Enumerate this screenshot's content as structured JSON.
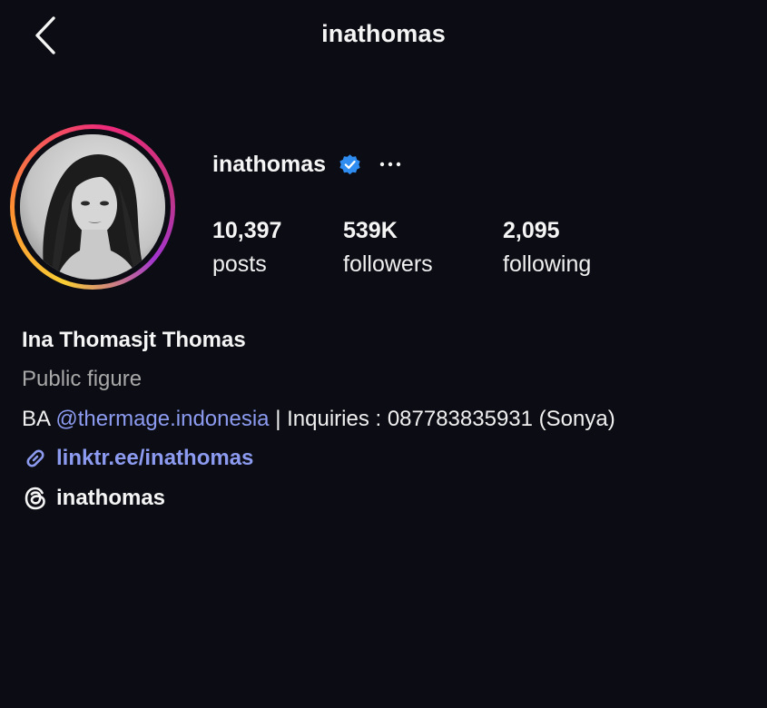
{
  "header": {
    "title": "inathomas",
    "back_icon": "chevron-left-icon"
  },
  "profile": {
    "username": "inathomas",
    "verified_icon": "verified-badge-icon",
    "more_icon": "ellipsis-icon",
    "stats": [
      {
        "value": "10,397",
        "label": "posts"
      },
      {
        "value": "539K",
        "label": "followers"
      },
      {
        "value": "2,095",
        "label": "following"
      }
    ],
    "full_name": "Ina Thomasjt Thomas",
    "category": "Public figure",
    "bio": {
      "prefix": "BA ",
      "mention": "@thermage.indonesia",
      "suffix": " | Inquiries : 087783835931 (Sonya)"
    },
    "link": {
      "icon": "link-icon",
      "text": "linktr.ee/inathomas"
    },
    "threads": {
      "icon": "threads-icon",
      "text": "inathomas"
    }
  },
  "colors": {
    "background": "#0c0d14",
    "link": "#8c9bf0",
    "verified": "#2f8cf0",
    "muted": "#a8a8a8"
  }
}
